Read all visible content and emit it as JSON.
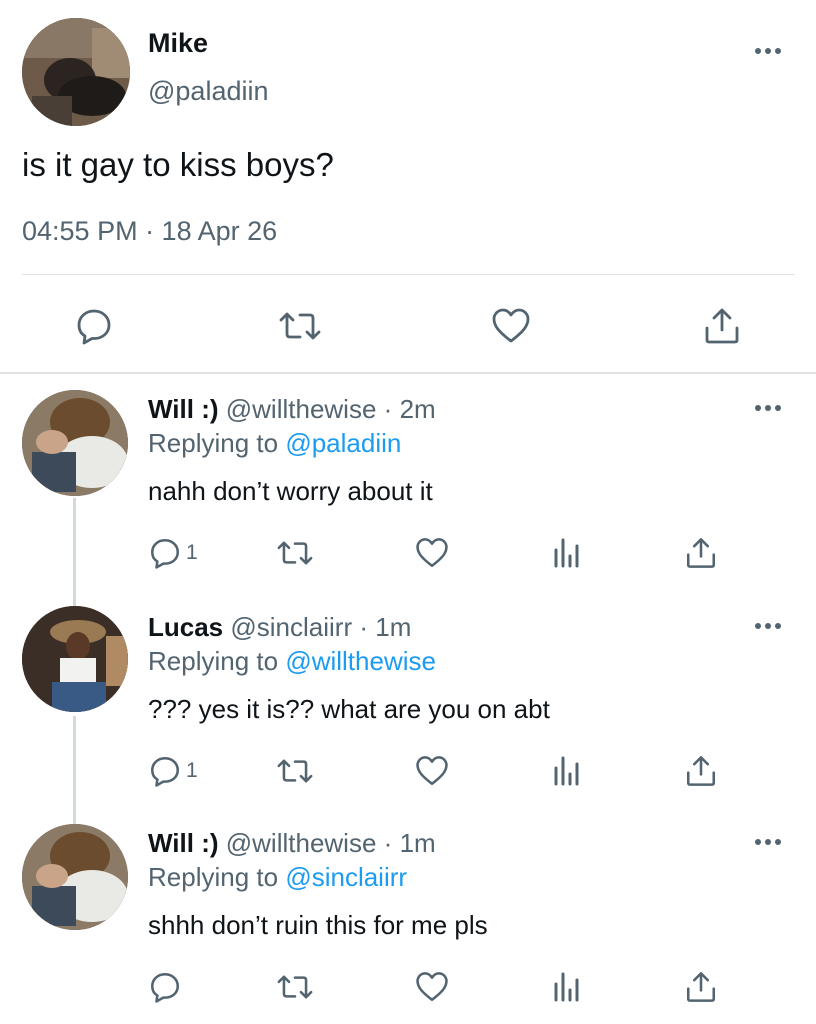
{
  "main_tweet": {
    "name": "Mike",
    "handle": "@paladiin",
    "text": "is it gay to kiss boys?",
    "timestamp": "04:55 PM · 18 Apr 26",
    "actions": [
      "reply-icon",
      "retweet-icon",
      "like-icon",
      "share-icon"
    ]
  },
  "replies": [
    {
      "name": "Will :)",
      "handle": "@willthewise",
      "time": "2m",
      "replying_prefix": "Replying to ",
      "replying_to": "@paladiin",
      "text": "nahh don’t worry about it",
      "reply_count": "1"
    },
    {
      "name": "Lucas",
      "handle": "@sinclaiirr",
      "time": "1m",
      "replying_prefix": "Replying to ",
      "replying_to": "@willthewise",
      "text": "??? yes it is?? what are you on abt",
      "reply_count": "1"
    },
    {
      "name": "Will :)",
      "handle": "@willthewise",
      "time": "1m",
      "replying_prefix": "Replying to ",
      "replying_to": "@sinclaiirr",
      "text": "shhh don’t ruin this for me pls",
      "reply_count": ""
    }
  ],
  "colors": {
    "text": "#0f1419",
    "secondary": "#536471",
    "link": "#1d9bf0",
    "divider": "#dfe3e6",
    "thread_line": "#cfd9de"
  }
}
